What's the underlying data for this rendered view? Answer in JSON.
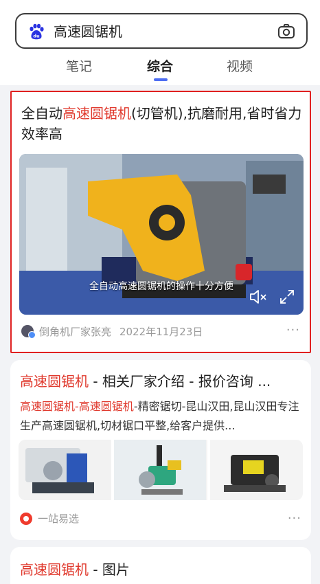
{
  "search": {
    "query": "高速圆锯机"
  },
  "tabs": [
    {
      "label": "笔记"
    },
    {
      "label": "综合"
    },
    {
      "label": "视频"
    }
  ],
  "results": [
    {
      "title_pre": "全自动",
      "title_highlight": "高速圆锯机",
      "title_post": "(切管机),抗磨耐用,省时省力效率高",
      "video_caption": "全自动高速圆锯机的操作十分方便",
      "author": "倒角机厂家张亮",
      "date": "2022年11月23日",
      "more": "···"
    },
    {
      "title_highlight": "高速圆锯机",
      "title_post": " - 相关厂家介绍 - 报价咨询 ...",
      "snippet_hl1": "高速圆锯机",
      "snippet_sep": "-",
      "snippet_hl2": "高速圆锯机",
      "snippet_rest": "-精密锯切-昆山汉田,昆山汉田专注生产高速圆锯机,切材锯口平整,给客户提供...",
      "source": "一站易选",
      "more": "···"
    },
    {
      "title_highlight": "高速圆锯机",
      "title_post": " - 图片"
    }
  ]
}
